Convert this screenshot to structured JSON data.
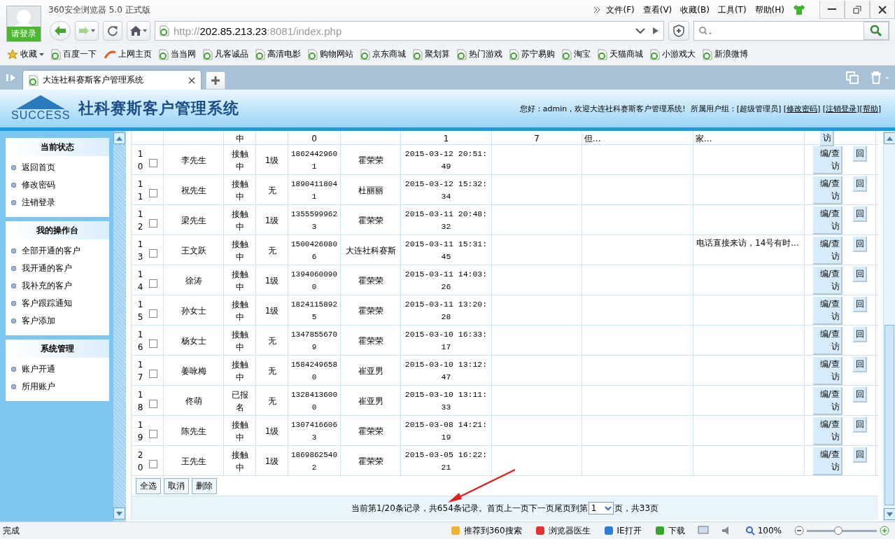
{
  "browser": {
    "login": "请登录",
    "title": "360安全浏览器 5.0 正式版",
    "menu": [
      "文件(F)",
      "查看(V)",
      "收藏(B)",
      "工具(T)",
      "帮助(H)"
    ],
    "url_host": "http://",
    "url_main": "202.85.213.23",
    "url_rest": ":8081/index.php",
    "bookmarks": [
      {
        "label": "收藏",
        "kind": "star"
      },
      {
        "label": "百度一下",
        "kind": "page"
      },
      {
        "label": "上网主页",
        "kind": "hao"
      },
      {
        "label": "当当网",
        "kind": "page"
      },
      {
        "label": "凡客诚品",
        "kind": "page"
      },
      {
        "label": "高清电影",
        "kind": "page"
      },
      {
        "label": "购物网站",
        "kind": "page"
      },
      {
        "label": "京东商城",
        "kind": "page"
      },
      {
        "label": "聚划算",
        "kind": "page"
      },
      {
        "label": "热门游戏",
        "kind": "page"
      },
      {
        "label": "苏宁易购",
        "kind": "page"
      },
      {
        "label": "淘宝",
        "kind": "page"
      },
      {
        "label": "天猫商城",
        "kind": "page"
      },
      {
        "label": "小游戏大",
        "kind": "page"
      },
      {
        "label": "新浪微博",
        "kind": "page"
      }
    ],
    "tabs": [
      {
        "label": "大连社科赛斯客户管理系统",
        "selected": true
      }
    ]
  },
  "header": {
    "logo_word": "SUCCESS",
    "title": "社科赛斯客户管理系统",
    "greeting": "您好：admin，欢迎大连社科赛斯客户管理系统!  所属用户组：",
    "group": "[超级管理员] [",
    "links": [
      {
        "label": "修改密码",
        "after": "] ["
      },
      {
        "label": "注销登录",
        "after": "]["
      },
      {
        "label": "帮助",
        "after": "]"
      }
    ]
  },
  "sidebar": [
    {
      "title": "当前状态",
      "items": [
        "返回首页",
        "修改密码",
        "注销登录"
      ]
    },
    {
      "title": "我的操作台",
      "items": [
        "全部开通的客户",
        "我开通的客户",
        "我补充的客户",
        "客户跟踪通知",
        "客户添加"
      ]
    },
    {
      "title": "系统管理",
      "items": [
        "账户开通",
        "所用账户"
      ]
    }
  ],
  "partial_row": {
    "status": "中",
    "phone": "0",
    "date": "1",
    "column_8": "7",
    "column_9": "但...",
    "note": "家...",
    "action": "访"
  },
  "rows": [
    {
      "no": "10",
      "checked": false,
      "name": "李先生",
      "status": "接触中",
      "level": "1级",
      "phone": "18624429601",
      "owner": "霍荣荣",
      "date": "2015-03-12 20:51:49",
      "note": ""
    },
    {
      "no": "11",
      "checked": false,
      "name": "祝先生",
      "status": "接触中",
      "level": "无",
      "phone": "18904118041",
      "owner": "杜丽丽",
      "date": "2015-03-12 15:32:34",
      "note": ""
    },
    {
      "no": "12",
      "checked": false,
      "name": "梁先生",
      "status": "接触中",
      "level": "1级",
      "phone": "13555999623",
      "owner": "霍荣荣",
      "date": "2015-03-11 20:48:32",
      "note": ""
    },
    {
      "no": "13",
      "checked": false,
      "name": "王文跃",
      "status": "接触中",
      "level": "无",
      "phone": "15004260806",
      "owner": "大连社科赛斯",
      "date": "2015-03-11 15:31:45",
      "note": "电话直接来访，14号有时..."
    },
    {
      "no": "14",
      "checked": false,
      "name": "徐涛",
      "status": "接触中",
      "level": "1级",
      "phone": "13940600900",
      "owner": "霍荣荣",
      "date": "2015-03-11 14:03:26",
      "note": ""
    },
    {
      "no": "15",
      "checked": false,
      "name": "孙女士",
      "status": "接触中",
      "level": "1级",
      "phone": "18241158925",
      "owner": "霍荣荣",
      "date": "2015-03-11 13:20:28",
      "note": ""
    },
    {
      "no": "16",
      "checked": false,
      "name": "杨女士",
      "status": "接触中",
      "level": "无",
      "phone": "13478556709",
      "owner": "霍荣荣",
      "date": "2015-03-10 16:33:17",
      "note": ""
    },
    {
      "no": "17",
      "checked": false,
      "name": "姜咏梅",
      "status": "接触中",
      "level": "无",
      "phone": "15842496580",
      "owner": "崔亚男",
      "date": "2015-03-10 13:12:47",
      "note": ""
    },
    {
      "no": "18",
      "checked": false,
      "name": "佟萌",
      "status": "已报名",
      "level": "无",
      "phone": "13284136000",
      "owner": "崔亚男",
      "date": "2015-03-10 13:11:33",
      "note": ""
    },
    {
      "no": "19",
      "checked": false,
      "name": "陈先生",
      "status": "接触中",
      "level": "1级",
      "phone": "13074166063",
      "owner": "霍荣荣",
      "date": "2015-03-08 14:21:19",
      "note": ""
    },
    {
      "no": "20",
      "checked": false,
      "name": "王先生",
      "status": "接触中",
      "level": "1级",
      "phone": "18698625402",
      "owner": "霍荣荣",
      "date": "2015-03-05 16:22:21",
      "note": ""
    }
  ],
  "row_actions": [
    [
      "编/查访",
      "回"
    ],
    [
      "编/查访",
      "回"
    ],
    [
      "编/查访",
      "回"
    ],
    [
      "编/查访",
      "回"
    ],
    [
      "编/查访",
      "回"
    ],
    [
      "编/查访",
      "回"
    ],
    [
      "编/查访",
      "回"
    ],
    [
      "编/查访",
      "回"
    ],
    [
      "编/查访",
      "回"
    ],
    [
      "编/查访",
      "回"
    ],
    [
      "编/查访",
      "回"
    ]
  ],
  "bulk_buttons": [
    "全选",
    "取消",
    "删除"
  ],
  "pagination": {
    "text": "当前第1/20条记录，共654条记录。首页上一页下一页尾页到第",
    "page": "1",
    "suffix": "页，共33页"
  },
  "status_bar": {
    "text": "完成",
    "items": [
      "推荐到360搜索",
      "浏览器医生",
      "IE打开",
      "下载"
    ],
    "zoom": "100%",
    "level": 0.45
  }
}
